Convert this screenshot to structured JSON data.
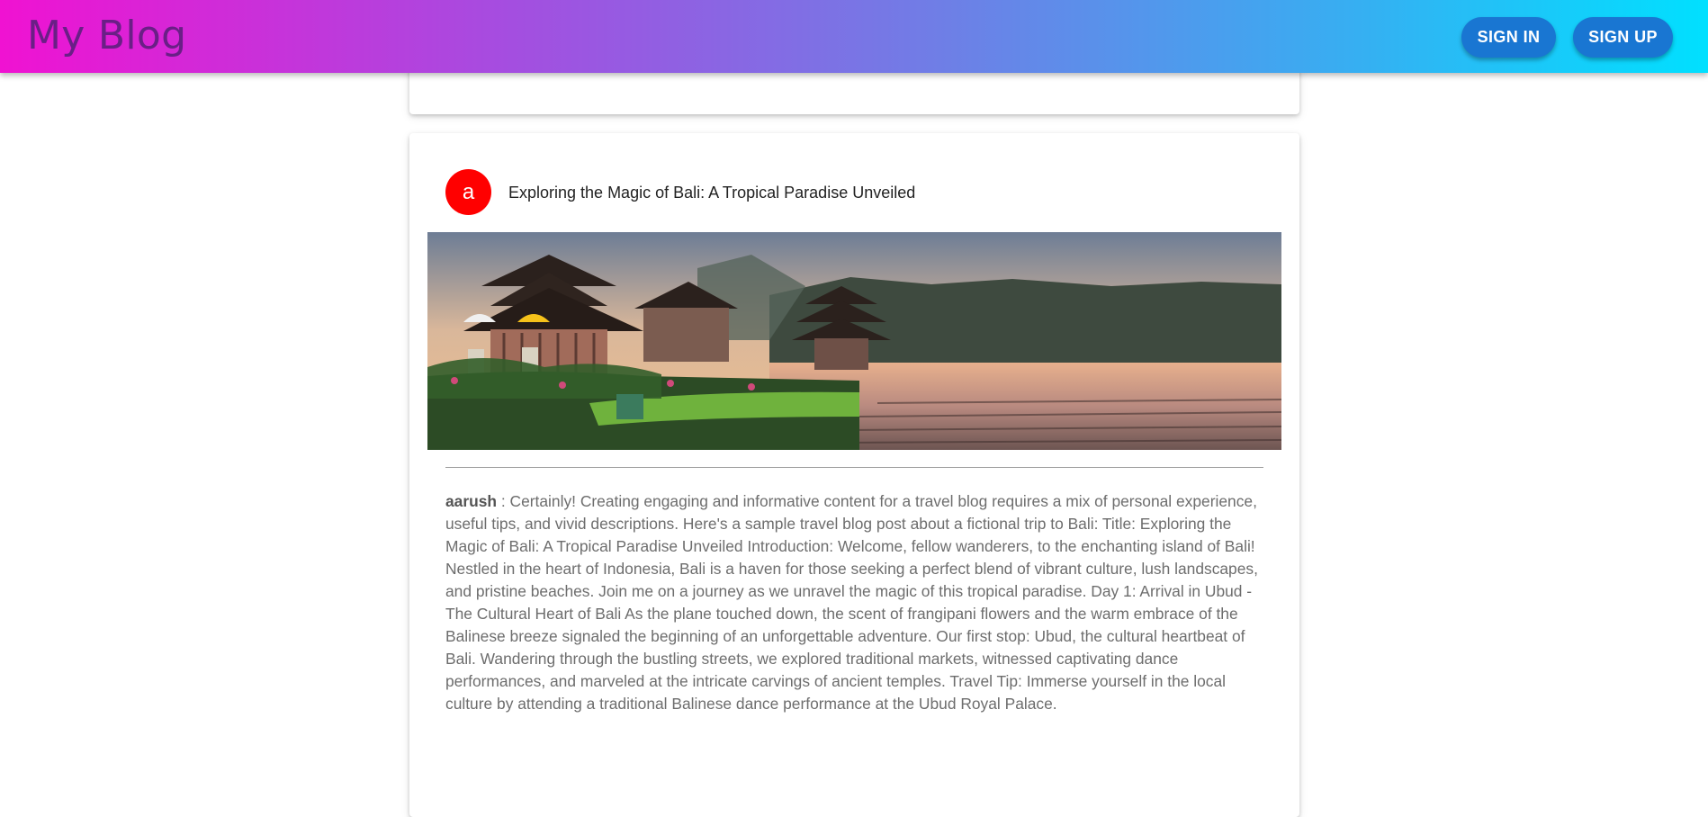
{
  "header": {
    "brand": "My Blog",
    "sign_in_label": "SIGN IN",
    "sign_up_label": "SIGN UP"
  },
  "post": {
    "avatar_letter": "a",
    "title": "Exploring the Magic of Bali: A Tropical Paradise Unveiled",
    "image_alt_icon": "bali-temple-photo",
    "author": "aarush",
    "separator": " : ",
    "body": "Certainly! Creating engaging and informative content for a travel blog requires a mix of personal experience, useful tips, and vivid descriptions. Here's a sample travel blog post about a fictional trip to Bali: Title: Exploring the Magic of Bali: A Tropical Paradise Unveiled Introduction: Welcome, fellow wanderers, to the enchanting island of Bali! Nestled in the heart of Indonesia, Bali is a haven for those seeking a perfect blend of vibrant culture, lush landscapes, and pristine beaches. Join me on a journey as we unravel the magic of this tropical paradise. Day 1: Arrival in Ubud - The Cultural Heart of Bali As the plane touched down, the scent of frangipani flowers and the warm embrace of the Balinese breeze signaled the beginning of an unforgettable adventure. Our first stop: Ubud, the cultural heartbeat of Bali. Wandering through the bustling streets, we explored traditional markets, witnessed captivating dance performances, and marveled at the intricate carvings of ancient temples. Travel Tip: Immerse yourself in the local culture by attending a traditional Balinese dance performance at the Ubud Royal Palace."
  },
  "colors": {
    "avatar": "#ff0000",
    "button": "#1976d2",
    "brand_text": "#6a1f86"
  }
}
